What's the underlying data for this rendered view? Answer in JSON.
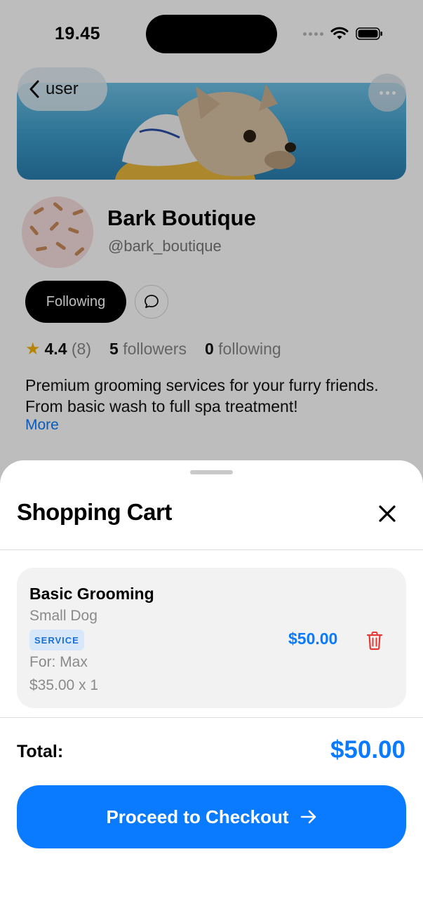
{
  "status_bar": {
    "time": "19.45"
  },
  "profile": {
    "back_label": "user",
    "name": "Bark Boutique",
    "handle": "@bark_boutique",
    "follow_button": "Following",
    "rating": "4.4",
    "rating_count": "(8)",
    "followers_count": "5",
    "followers_label": "followers",
    "following_count": "0",
    "following_label": "following",
    "bio": "Premium grooming services for your furry friends. From basic wash to full spa treatment!",
    "more_link": "More"
  },
  "cart": {
    "title": "Shopping Cart",
    "items": [
      {
        "name": "Basic Grooming",
        "variant": "Small Dog",
        "badge": "SERVICE",
        "for": "For: Max",
        "unit_qty": "$35.00 x 1",
        "price": "$50.00"
      }
    ],
    "total_label": "Total:",
    "total_value": "$50.00",
    "checkout_label": "Proceed to Checkout"
  },
  "colors": {
    "accent": "#0a7bff",
    "delete": "#e53935",
    "badge_bg": "#d8e8fa",
    "star": "#f4b400"
  }
}
